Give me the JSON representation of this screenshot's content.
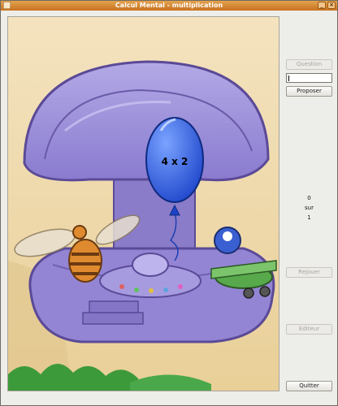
{
  "window": {
    "title": "Calcul Mental - multiplication"
  },
  "balloon": {
    "question": "4 x 2",
    "color": "#2f5fe0"
  },
  "panel": {
    "question_label": "Question",
    "answer_value": "",
    "propose_label": "Proposer",
    "score_value": "0",
    "score_sep": "sur",
    "score_total": "1",
    "replay_label": "Rejouer",
    "editor_label": "Editeur",
    "quit_label": "Quitter"
  },
  "colors": {
    "titlebar": "#d8893a",
    "mushroom": "#8e7ed0",
    "sand": "#ecd3a2"
  },
  "icons": [
    "app-icon",
    "minimize-icon",
    "close-icon"
  ]
}
